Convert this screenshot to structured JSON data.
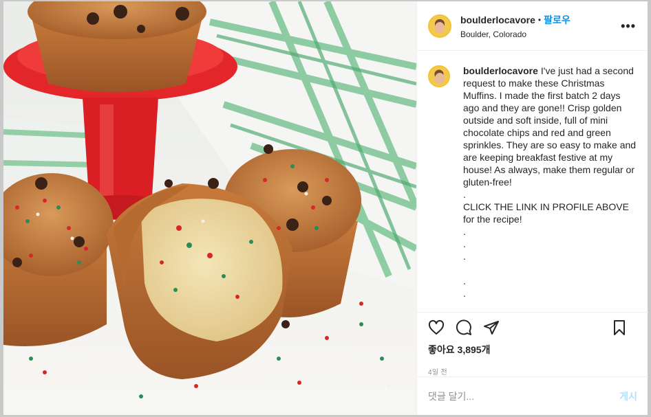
{
  "post": {
    "image_alt": "Christmas muffins with sprinkles and chocolate chips",
    "header": {
      "username": "boulderlocavore",
      "separator": "•",
      "follow_label": "팔로우",
      "location": "Boulder, Colorado",
      "more_icon": "more-options-icon",
      "more_label": "•••"
    },
    "caption": {
      "username": "boulderlocavore",
      "lines": [
        "I've just had a second request to make these Christmas Muffins. I made the first batch 2 days ago and they are gone!! Crisp golden outside and soft inside, full of mini chocolate chips and red and green sprinkles. They are so easy to make and are keeping breakfast festive at my house! As always, make them regular or gluten-free!",
        ".",
        "CLICK THE LINK IN PROFILE ABOVE for the recipe!",
        ".",
        ".",
        ".",
        "",
        ".",
        "."
      ]
    },
    "actions": {
      "like_icon": "heart-icon",
      "comment_icon": "comment-icon",
      "share_icon": "share-icon",
      "save_icon": "bookmark-icon"
    },
    "likes_label": "좋아요 3,895개",
    "timestamp": "4일 전",
    "comment_input": {
      "placeholder": "댓글 달기...",
      "post_label": "게시"
    },
    "colors": {
      "follow_blue": "#0095f6",
      "post_disabled": "#b2dffc",
      "muted_text": "#8e8e8e"
    }
  }
}
